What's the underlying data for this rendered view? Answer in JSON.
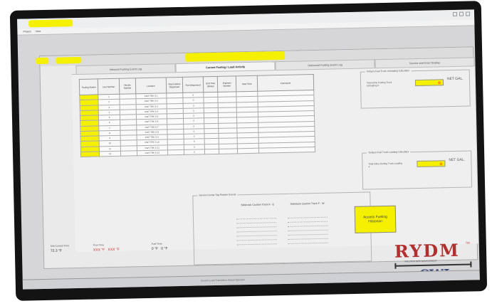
{
  "menu": [
    "Project",
    "View"
  ],
  "tabs": [
    {
      "label": "Inbound Fueling Event Log",
      "active": false
    },
    {
      "label": "Current Fueling / Load Activity",
      "active": true
    },
    {
      "label": "Outbound Fueling Event Log",
      "active": false
    },
    {
      "label": "Service and Error Display",
      "active": false
    }
  ],
  "grid": {
    "columns": [
      "Fueling Station",
      "Line Number",
      "Nozzle Number",
      "Location",
      "Total Gallons Dispensed",
      "Fuel Dispensed",
      "End Time (Delay)",
      "Engineer Number",
      "Start Time",
      "Comments"
    ],
    "rows": [
      {
        "line": "1",
        "location": "CW7 TRK S-1",
        "gallons": "0"
      },
      {
        "line": "2",
        "location": "CW7 TRK S-2",
        "gallons": "0"
      },
      {
        "line": "3",
        "location": "CW7 TRK S-3",
        "gallons": "0"
      },
      {
        "line": "4",
        "location": "CW7 TRK S-4",
        "gallons": "0"
      },
      {
        "line": "5",
        "location": "CW7 TRK S-5",
        "gallons": "0"
      },
      {
        "line": "6",
        "location": "CW7 TRK S-6",
        "gallons": "0"
      },
      {
        "line": "7",
        "location": "CW7 TRK S-7",
        "gallons": "0"
      },
      {
        "line": "8",
        "location": "CW7 TRK S-8",
        "gallons": "0"
      },
      {
        "line": "9",
        "location": "CW7 TRK S-9",
        "gallons": "0"
      },
      {
        "line": "10",
        "location": "CW7 TRK S-10",
        "gallons": "0"
      },
      {
        "line": "11",
        "location": "CW7 TRK S-11",
        "gallons": "0"
      },
      {
        "line": "12",
        "location": "CW7 TRK S-12",
        "gallons": "0"
      }
    ]
  },
  "unloading": {
    "legend": "Today's Fuel Truck Unloading Calculator",
    "label": "Total Inline Fueling Truck Unloading #",
    "unit": "NET GAL."
  },
  "loading": {
    "legend": "Today's Fuel Truck Loading Calculator",
    "label": "Total Inline Fueling Truck Loading #",
    "unit": "NET GAL."
  },
  "sensor": {
    "legend": "Service Center Tag Reader Events",
    "col1": "Sidetrack Caution Track A - E",
    "col2": "Sidetrack Caution Track F - W"
  },
  "history_button": "Access Fueling Historian",
  "logo": {
    "brand": "RYDM",
    "tm": "TM",
    "tagline": "RAILYARD DATA MANAGEMENT",
    "company": "CWI"
  },
  "status": {
    "current_time_label": "Site Current Time",
    "current_time_value": "72.3 °F",
    "pour_label": "Pour Time",
    "pour_value_1": "XXX °F",
    "pour_value_2": "XXX °F",
    "fuel_label": "Fuel Time",
    "fuel_value_1": "0 °F",
    "fuel_value_2": "0 °F"
  },
  "taskbar": {
    "text": "Current Load  Transitions  Status  Operator"
  }
}
